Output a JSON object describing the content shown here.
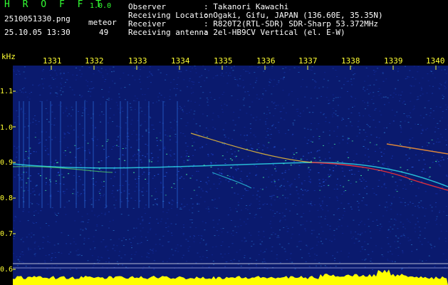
{
  "header": {
    "app_name": "H R O F F T",
    "app_version": "1.0.0",
    "filename": "2510051330.png",
    "datetime": "25.10.05 13:30",
    "mode_label": "meteor",
    "count": "49"
  },
  "info": [
    {
      "key": "Observer",
      "value": ": Takanori Kawachi"
    },
    {
      "key": "Receiving Location",
      "value": ": Ogaki, Gifu, JAPAN (136.60E, 35.35N)"
    },
    {
      "key": "Receiver",
      "value": ": R820T2(RTL-SDR) SDR-Sharp 53.372MHz"
    },
    {
      "key": "Receiving antenna",
      "value": ": 2el-HB9CV Vertical (el. E-W)"
    }
  ],
  "axes": {
    "y_unit": "kHz",
    "y_ticks": [
      "1.1",
      "1.0",
      "0.9",
      "0.8",
      "0.7",
      "0.6"
    ],
    "x_ticks": [
      "1331",
      "1332",
      "1333",
      "1334",
      "1335",
      "1336",
      "1337",
      "1338",
      "1339",
      "1340"
    ]
  },
  "colors": {
    "label_green": "#33ff33",
    "tick_yellow": "#ffff33",
    "background_blue": "#0a1a6e",
    "trace_cyan": "#33ffff",
    "trace_red": "#ff3333"
  }
}
